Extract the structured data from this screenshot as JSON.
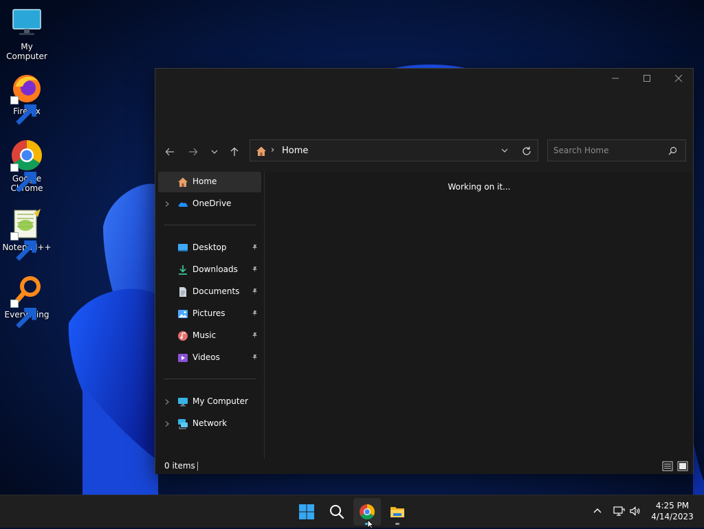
{
  "desktop": {
    "icons": [
      {
        "label": "My Computer",
        "icon": "monitor-icon"
      },
      {
        "label": "Firefox",
        "icon": "firefox-icon"
      },
      {
        "label": "Google Chrome",
        "icon": "chrome-icon"
      },
      {
        "label": "Notepad++",
        "icon": "notepadpp-icon"
      },
      {
        "label": "Everything",
        "icon": "everything-search-icon"
      }
    ]
  },
  "explorer": {
    "window_controls": {
      "minimize": "minimize-icon",
      "maximize": "maximize-icon",
      "close": "close-icon"
    },
    "address": {
      "crumb": "Home",
      "separator": "›"
    },
    "search": {
      "placeholder": "Search Home"
    },
    "sidebar": {
      "top": [
        {
          "label": "Home",
          "icon": "home-icon",
          "selected": true
        },
        {
          "label": "OneDrive",
          "icon": "onedrive-icon",
          "expandable": true
        }
      ],
      "pinned": [
        {
          "label": "Desktop",
          "icon": "desktop-folder-icon"
        },
        {
          "label": "Downloads",
          "icon": "downloads-icon"
        },
        {
          "label": "Documents",
          "icon": "documents-icon"
        },
        {
          "label": "Pictures",
          "icon": "pictures-icon"
        },
        {
          "label": "Music",
          "icon": "music-icon"
        },
        {
          "label": "Videos",
          "icon": "videos-icon"
        }
      ],
      "bottom": [
        {
          "label": "My Computer",
          "icon": "computer-icon",
          "expandable": true
        },
        {
          "label": "Network",
          "icon": "network-icon",
          "expandable": true
        }
      ]
    },
    "content": {
      "message": "Working on it..."
    },
    "status": {
      "item_count": "0 items"
    }
  },
  "taskbar": {
    "apps": [
      "start-icon",
      "search-icon",
      "chrome-icon",
      "file-explorer-icon"
    ],
    "active_app": "chrome-icon",
    "clock": {
      "time": "4:25 PM",
      "date": "4/14/2023"
    }
  },
  "colors": {
    "accent": "#4cc2ff",
    "window_bg": "#191919",
    "taskbar_bg": "#1f1f1f"
  }
}
